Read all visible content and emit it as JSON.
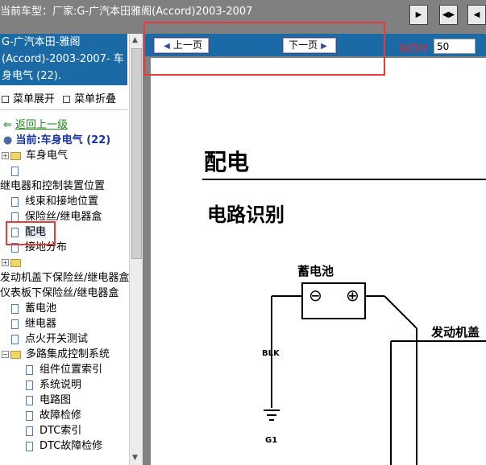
{
  "topbar": {
    "title": "当前车型：厂家:G-广汽本田雅阁(Accord)2003-2007",
    "buttons": [
      "arrow-right-icon",
      "expand-icon",
      "arrow-left-icon"
    ]
  },
  "left_panel": {
    "header": "G-广汽本田-雅阁(Accord)-2003-2007- 车身电气 (22).",
    "expand_label": "菜单展开",
    "collapse_label": "菜单折叠",
    "back_label": "返回上一级",
    "current_label": "当前:车身电气 (22)",
    "items": [
      {
        "label": "车身电气",
        "icon": "folder"
      },
      {
        "label": "",
        "icon": "doc"
      },
      {
        "label": "继电器和控制装置位置",
        "icon": "none"
      },
      {
        "label": "线束和接地位置",
        "icon": "doc"
      },
      {
        "label": "保险丝/继电器盒",
        "icon": "doc"
      },
      {
        "label": "配电",
        "icon": "doc",
        "selected": true
      },
      {
        "label": "接地分布",
        "icon": "doc"
      },
      {
        "label": "",
        "icon": "folder"
      },
      {
        "label": "发动机盖下保险丝/继电器盒",
        "icon": "none"
      },
      {
        "label": "仪表板下保险丝/继电器盒",
        "icon": "none"
      },
      {
        "label": "蓄电池",
        "icon": "doc"
      },
      {
        "label": "继电器",
        "icon": "doc"
      },
      {
        "label": "点火开关测试",
        "icon": "doc"
      },
      {
        "label": "多路集成控制系统",
        "icon": "folder"
      },
      {
        "label": "组件位置索引",
        "icon": "doc"
      },
      {
        "label": "系统说明",
        "icon": "doc"
      },
      {
        "label": "电路图",
        "icon": "doc"
      },
      {
        "label": "故障检修",
        "icon": "doc"
      },
      {
        "label": "DTC索引",
        "icon": "doc"
      },
      {
        "label": "DTC故障检修",
        "icon": "doc"
      }
    ]
  },
  "nav": {
    "prev_label": "上一页",
    "next_label": "下一页",
    "page_label": "当前为",
    "page_value": "50"
  },
  "document": {
    "title": "配电",
    "subtitle": "电路识别",
    "battery_label": "蓄电池",
    "wire_label": "BLK",
    "ground_label": "G1",
    "engine_label": "发动机盖",
    "minus": "⊖",
    "plus": "⊕"
  },
  "colors": {
    "accent": "#1b6aa5",
    "highlight": "#e53c3c"
  }
}
